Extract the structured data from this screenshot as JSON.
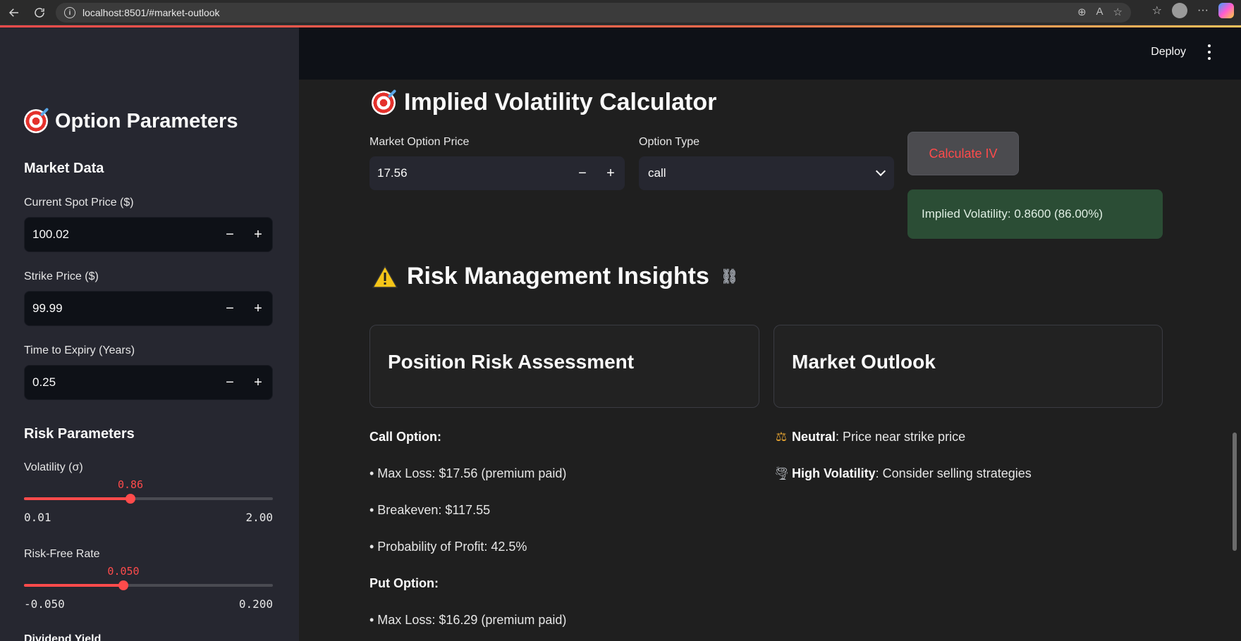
{
  "browser": {
    "url": "localhost:8501/#market-outlook"
  },
  "topbar": {
    "deploy_label": "Deploy"
  },
  "sidebar": {
    "title": "Option Parameters",
    "market_data_heading": "Market Data",
    "spot_label": "Current Spot Price ($)",
    "spot_value": "100.02",
    "strike_label": "Strike Price ($)",
    "strike_value": "99.99",
    "expiry_label": "Time to Expiry (Years)",
    "expiry_value": "0.25",
    "risk_heading": "Risk Parameters",
    "volatility": {
      "label": "Volatility (σ)",
      "value": "0.86",
      "min": "0.01",
      "max": "2.00"
    },
    "risk_free": {
      "label": "Risk-Free Rate",
      "value": "0.050",
      "min": "-0.050",
      "max": "0.200"
    },
    "dividend_label": "Dividend Yield"
  },
  "iv_section": {
    "title": "Implied Volatility Calculator",
    "market_price_label": "Market Option Price",
    "market_price_value": "17.56",
    "option_type_label": "Option Type",
    "option_type_value": "call",
    "calc_button": "Calculate IV",
    "result": "Implied Volatility: 0.8600 (86.00%)"
  },
  "risk_section": {
    "title": "Risk Management Insights",
    "position_card_title": "Position Risk Assessment",
    "outlook_card_title": "Market Outlook",
    "call_heading": "Call Option:",
    "call_max_loss": "• Max Loss: $17.56 (premium paid)",
    "call_breakeven": "• Breakeven: $117.55",
    "call_prob": "• Probability of Profit: 42.5%",
    "put_heading": "Put Option:",
    "put_max_loss": "• Max Loss: $16.29 (premium paid)",
    "outlook_neutral_bold": "Neutral",
    "outlook_neutral_text": ": Price near strike price",
    "outlook_vol_bold": "High Volatility",
    "outlook_vol_text": ": Consider selling strategies"
  }
}
